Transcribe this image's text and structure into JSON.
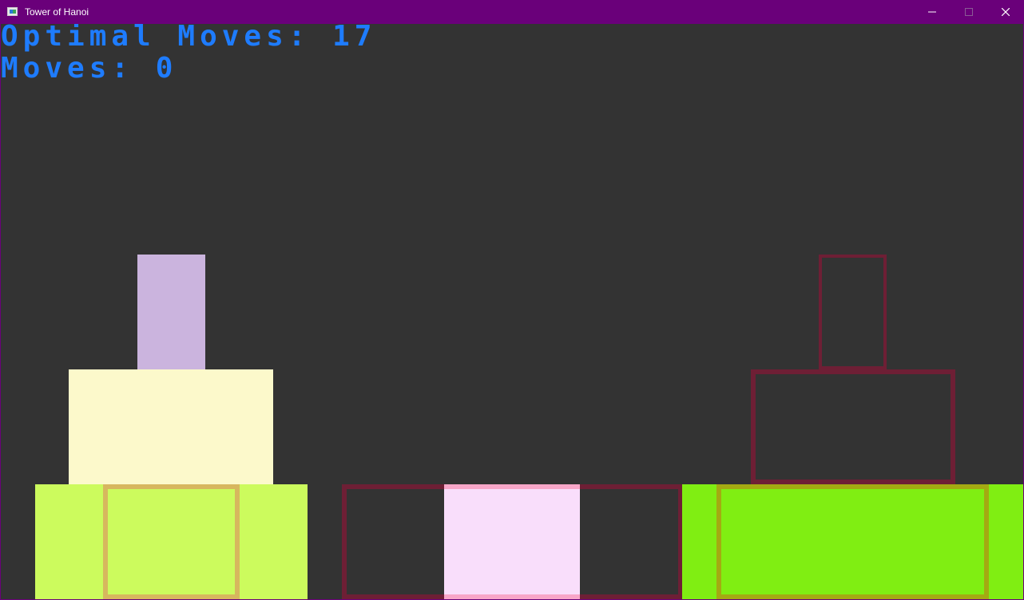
{
  "window": {
    "title": "Tower of Hanoi"
  },
  "hud": {
    "optimal_moves": "Optimal Moves: 17",
    "moves": "Moves: 0"
  },
  "colors": {
    "background": "#333333",
    "title_bar": "#6a007a",
    "hud_text": "#1e7cff",
    "disk_lavender": "#cbb4de",
    "disk_cream": "#fcf9cb",
    "disk_yellow_green": "#ccfb5d",
    "disk_gold_outline": "#d7b75e",
    "disk_maroon_outline": "#6e1f35",
    "disk_pink": "#f9defb",
    "disk_pink_outline": "#f8a6c8",
    "disk_bright_green": "#80ee12",
    "disk_olive_outline": "#a4aa12"
  }
}
